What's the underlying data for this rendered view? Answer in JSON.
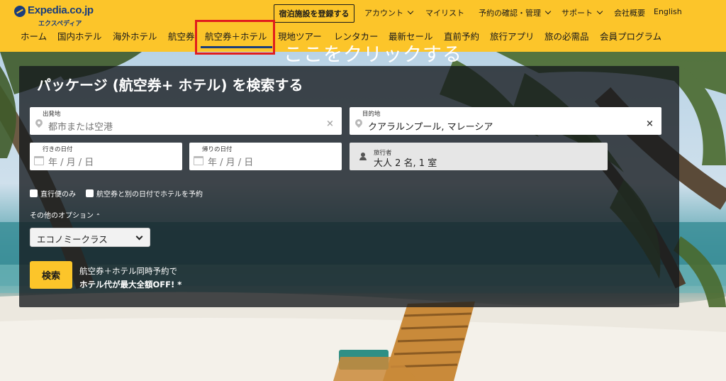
{
  "brand": {
    "logo_text": "Expedia.co.jp",
    "logo_sub": "エクスペディア",
    "color": "#1a3d7c",
    "header_color": "#fcc52a"
  },
  "utility_bar": {
    "register_button": "宿泊施設を登録する",
    "account": "アカウント",
    "my_list": "マイリスト",
    "bookings": "予約の確認・管理",
    "support": "サポート",
    "company": "会社概要",
    "language": "English"
  },
  "nav": {
    "items": [
      "ホーム",
      "国内ホテル",
      "海外ホテル",
      "航空券",
      "航空券＋ホテル",
      "現地ツアー",
      "レンタカー",
      "最新セール",
      "直前予約",
      "旅行アプリ",
      "旅の必需品",
      "会員プログラム"
    ],
    "active": "航空券＋ホテル"
  },
  "annotation": {
    "click_here": "ここをクリックする",
    "box_color": "#e11d1d"
  },
  "search": {
    "title": "パッケージ (航空券+ ホテル) を検索する",
    "origin_label": "出発地",
    "origin_placeholder": "都市または空港",
    "destination_label": "目的地",
    "destination_value": "クアラルンプール, マレーシア",
    "depart_label": "行きの日付",
    "depart_placeholder": "年 / 月 / 日",
    "return_label": "帰りの日付",
    "return_placeholder": "年 / 月 / 日",
    "travelers_label": "旅行者",
    "travelers_value": "大人 2 名, 1 室",
    "clear_icon": "×",
    "checkbox_nonstop": "直行便のみ",
    "checkbox_separate_dates": "航空券と別の日付でホテルを予約",
    "more_options": "その他のオプション",
    "cabin_class": "エコノミークラス",
    "search_button": "検索",
    "promo_line1": "航空券＋ホテル同時予約で",
    "promo_line2": "ホテル代が最大全額OFF! *"
  }
}
